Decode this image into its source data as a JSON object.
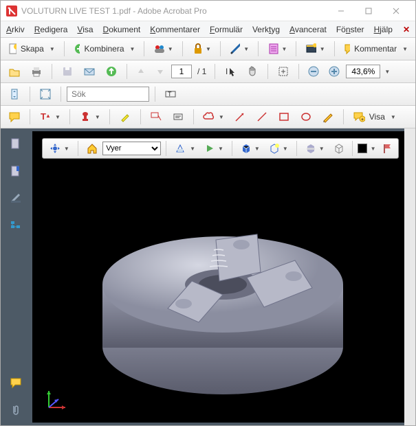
{
  "titlebar": {
    "title": "VOLUTURN LIVE TEST 1.pdf - Adobe Acrobat Pro"
  },
  "menu": {
    "arkiv": "Arkiv",
    "redigera": "Redigera",
    "visa": "Visa",
    "dokument": "Dokument",
    "kommentarer": "Kommentarer",
    "formular": "Formulär",
    "verktyg": "Verktyg",
    "avancerat": "Avancerat",
    "fonster": "Fönster",
    "hjalp": "Hjälp"
  },
  "toolbar1": {
    "skapa": "Skapa",
    "kombinera": "Kombinera",
    "kommentar": "Kommentar"
  },
  "nav": {
    "page_current": "1",
    "page_total": "/ 1",
    "zoom": "43,6%"
  },
  "search": {
    "placeholder": "Sök"
  },
  "annot": {
    "visa": "Visa"
  },
  "viewer3d": {
    "views_label": "Vyer"
  }
}
